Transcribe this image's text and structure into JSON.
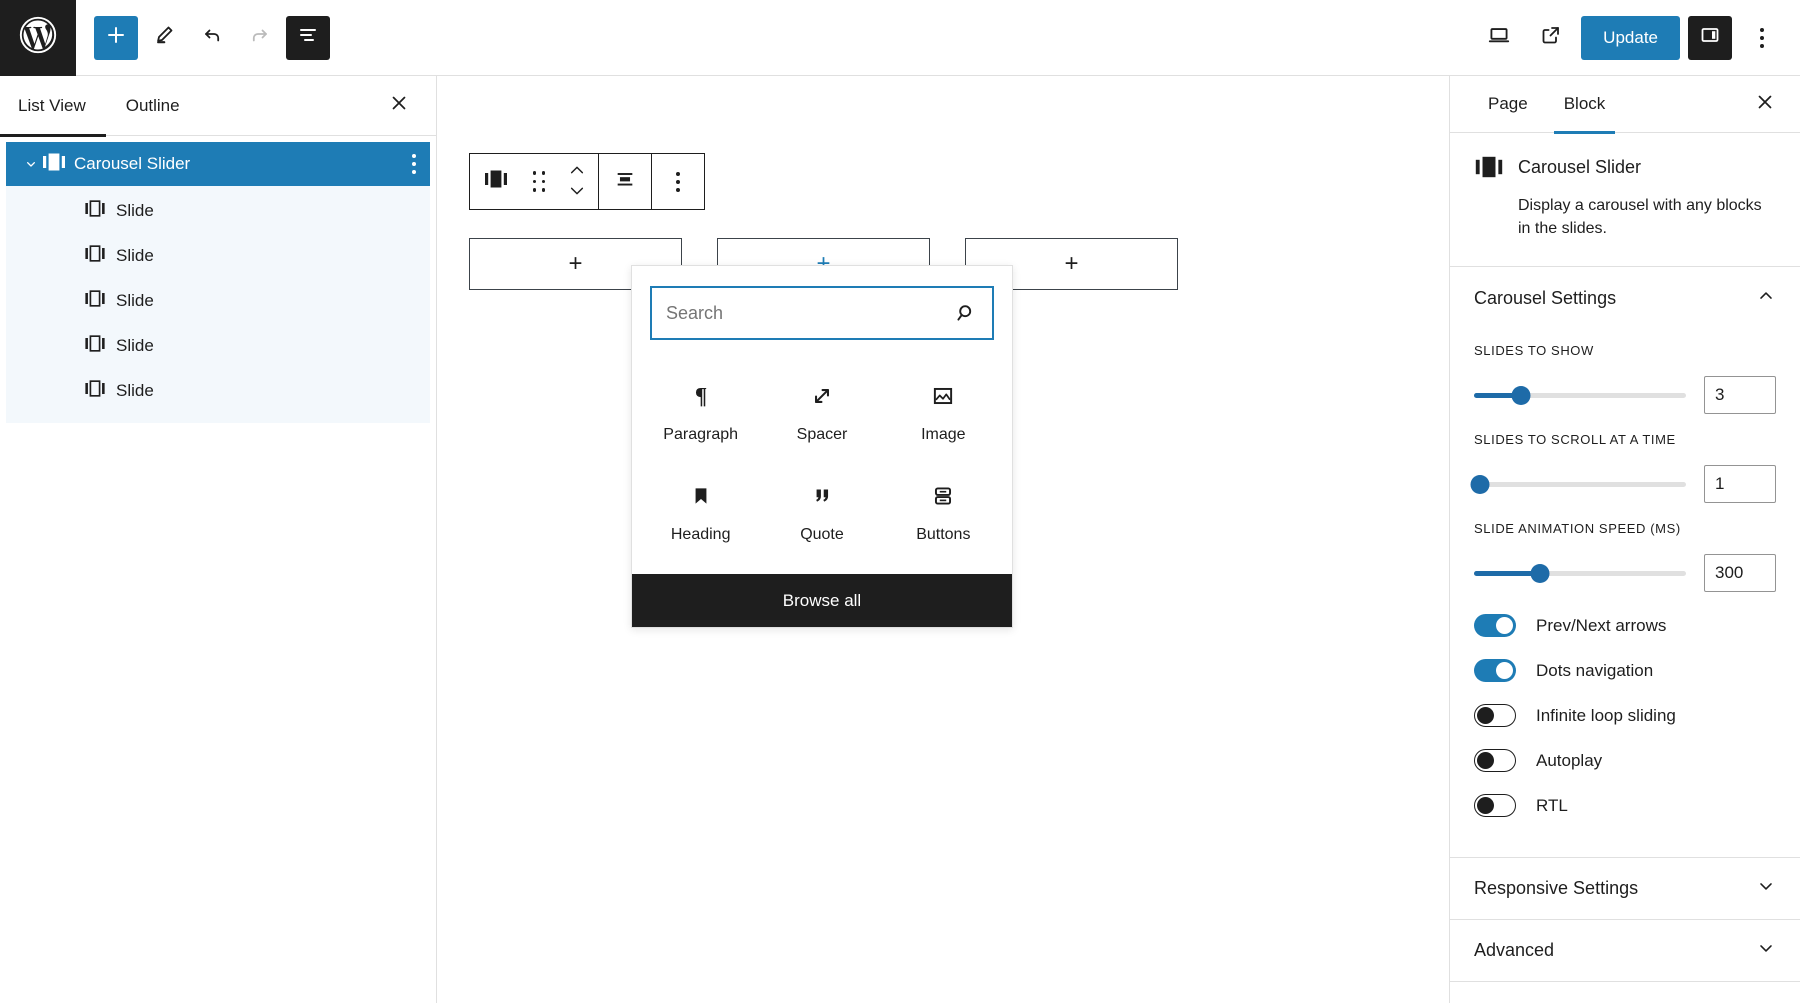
{
  "topbar": {
    "logo_icon": "wordpress-logo-icon",
    "add_block_label": "+",
    "add_block_icon": "plus-icon",
    "edit_icon": "pencil-icon",
    "undo_icon": "undo-arrow-icon",
    "redo_icon": "redo-arrow-icon",
    "listview_icon": "list-view-icon",
    "preview_icon": "desktop-preview-icon",
    "view_icon": "external-link-icon",
    "update_label": "Update",
    "settings_icon": "sidebar-panel-icon",
    "options_icon": "kebab-menu-icon",
    "accent": "#1e7cb5",
    "dark": "#1e1e1e"
  },
  "listview": {
    "tabs": [
      {
        "label": "List View",
        "active": true
      },
      {
        "label": "Outline",
        "active": false
      }
    ],
    "close_icon": "close-icon",
    "root": {
      "label": "Carousel Slider",
      "icon": "carousel-block-icon",
      "chevron_icon": "chevron-down-icon",
      "kebab_icon": "kebab-menu-icon"
    },
    "children": [
      {
        "label": "Slide",
        "icon": "slide-block-icon"
      },
      {
        "label": "Slide",
        "icon": "slide-block-icon"
      },
      {
        "label": "Slide",
        "icon": "slide-block-icon"
      },
      {
        "label": "Slide",
        "icon": "slide-block-icon"
      },
      {
        "label": "Slide",
        "icon": "slide-block-icon"
      }
    ]
  },
  "canvas": {
    "block_toolbar": {
      "block_icon": "carousel-block-icon",
      "drag_icon": "drag-handle-icon",
      "move_up_icon": "chevron-up-icon",
      "move_down_icon": "chevron-down-icon",
      "align_icon": "align-center-icon",
      "options_icon": "kebab-menu-icon"
    },
    "slides": [
      {
        "label": "+",
        "icon": "plus-icon",
        "active": false
      },
      {
        "label": "+",
        "icon": "plus-icon",
        "active": true
      },
      {
        "label": "+",
        "icon": "plus-icon",
        "active": false
      }
    ]
  },
  "inserter": {
    "search": {
      "value": "",
      "placeholder": "Search",
      "icon": "search-icon"
    },
    "blocks": [
      {
        "label": "Paragraph",
        "icon": "paragraph-icon"
      },
      {
        "label": "Spacer",
        "icon": "spacer-icon"
      },
      {
        "label": "Image",
        "icon": "image-icon"
      },
      {
        "label": "Heading",
        "icon": "heading-icon"
      },
      {
        "label": "Quote",
        "icon": "quote-icon"
      },
      {
        "label": "Buttons",
        "icon": "buttons-icon"
      }
    ],
    "browse_all_label": "Browse all"
  },
  "inspector": {
    "tabs": [
      {
        "label": "Page",
        "active": false
      },
      {
        "label": "Block",
        "active": true
      }
    ],
    "close_icon": "close-icon",
    "block": {
      "title": "Carousel Slider",
      "icon": "carousel-block-icon",
      "description": "Display a carousel with any blocks in the slides."
    },
    "carousel_settings": {
      "title": "Carousel Settings",
      "expanded": true,
      "chevron_icon": "chevron-up-icon",
      "ranges": [
        {
          "label": "Slides to show",
          "value": "3",
          "percent": 22
        },
        {
          "label": "Slides to scroll at a time",
          "value": "1",
          "percent": 0
        },
        {
          "label": "Slide animation speed (ms)",
          "value": "300",
          "percent": 31
        }
      ],
      "toggles": [
        {
          "label": "Prev/Next arrows",
          "on": true
        },
        {
          "label": "Dots navigation",
          "on": true
        },
        {
          "label": "Infinite loop sliding",
          "on": false
        },
        {
          "label": "Autoplay",
          "on": false
        },
        {
          "label": "RTL",
          "on": false
        }
      ]
    },
    "panels": [
      {
        "title": "Responsive Settings",
        "expanded": false,
        "chevron_icon": "chevron-down-icon"
      },
      {
        "title": "Advanced",
        "expanded": false,
        "chevron_icon": "chevron-down-icon"
      }
    ]
  }
}
